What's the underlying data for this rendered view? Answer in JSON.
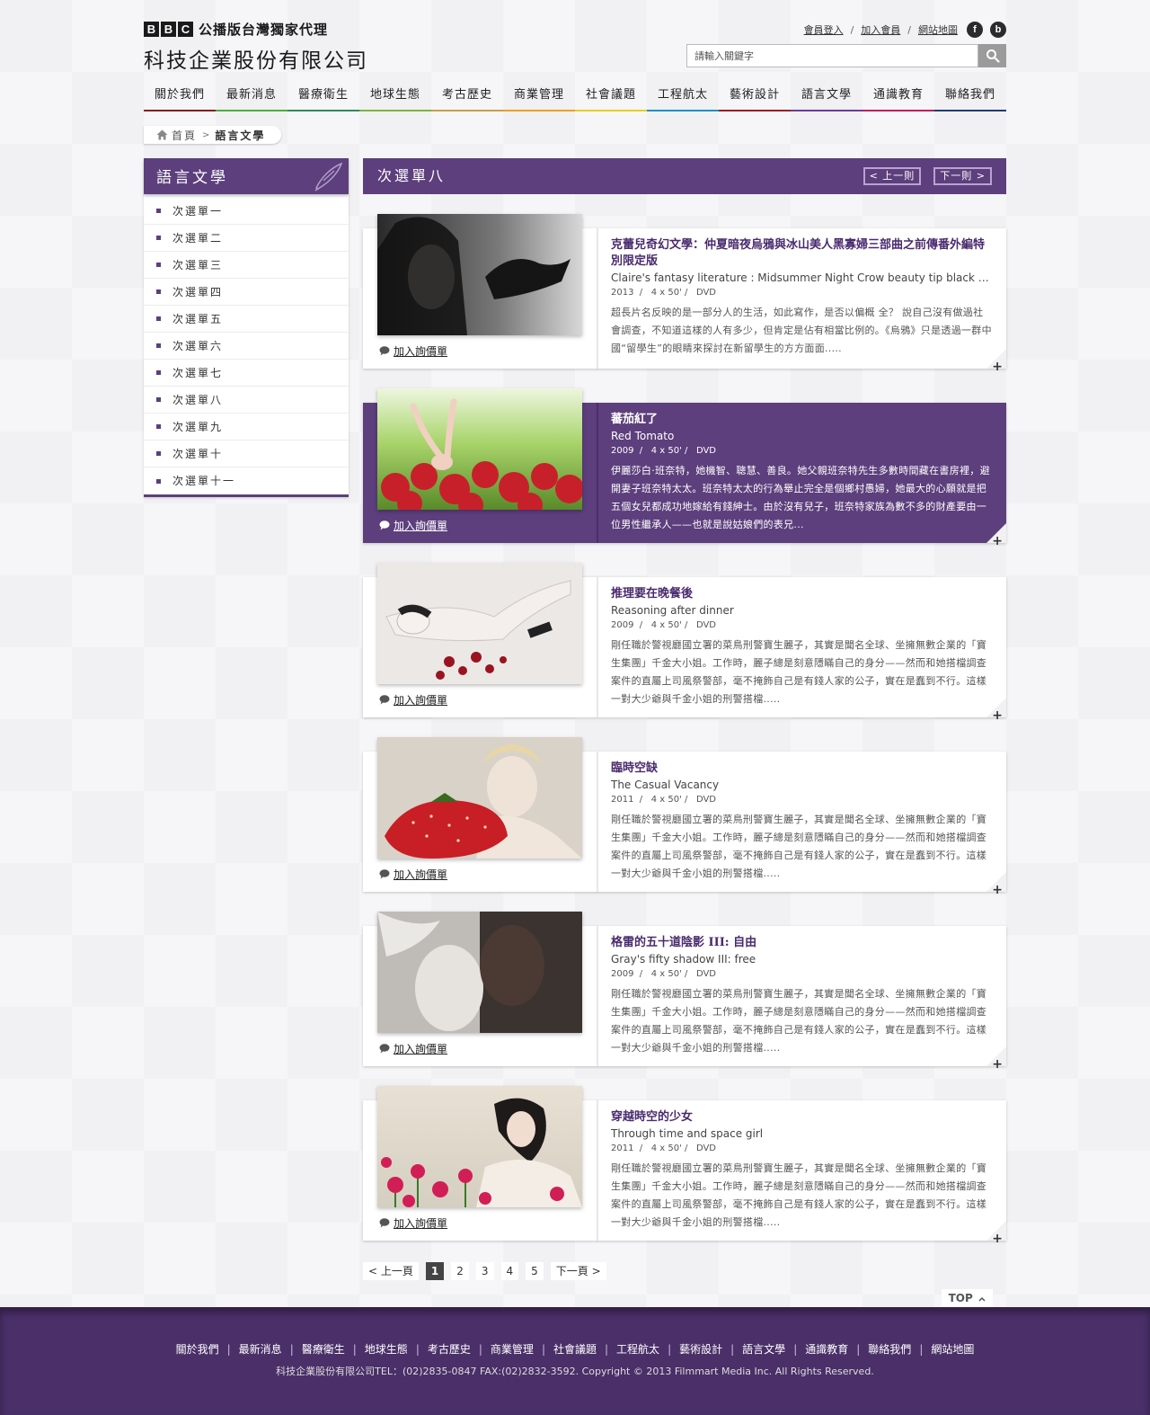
{
  "brand": {
    "bbc_letters": [
      "B",
      "B",
      "C"
    ],
    "subtitle": "公播版台灣獨家代理",
    "company": "科技企業股份有限公司"
  },
  "toplinks": {
    "login": "會員登入",
    "join": "加入會員",
    "sitemap": "網站地圖",
    "sep": "/",
    "facebook": "f",
    "blog": "b"
  },
  "search": {
    "placeholder": "請輸入關鍵字"
  },
  "nav": [
    {
      "label": "關於我們",
      "color": "#8b1a1a"
    },
    {
      "label": "最新消息",
      "color": "#4caf3a"
    },
    {
      "label": "醫療衛生",
      "color": "#2e8b57"
    },
    {
      "label": "地球生態",
      "color": "#7cb342"
    },
    {
      "label": "考古歷史",
      "color": "#c8a04a"
    },
    {
      "label": "商業管理",
      "color": "#f0a020"
    },
    {
      "label": "社會議題",
      "color": "#e8d020"
    },
    {
      "label": "工程航太",
      "color": "#1e90c8"
    },
    {
      "label": "藝術設計",
      "color": "#a01818"
    },
    {
      "label": "語言文學",
      "color": "#6a3d9a"
    },
    {
      "label": "通識教育",
      "color": "#c2185b"
    },
    {
      "label": "聯絡我們",
      "color": "#1a3a7a"
    }
  ],
  "breadcrumb": {
    "home": "首頁",
    "arrow": ">",
    "current": "語言文學"
  },
  "sidebar": {
    "title": "語言文學",
    "items": [
      "次選單一",
      "次選單二",
      "次選單三",
      "次選單四",
      "次選單五",
      "次選單六",
      "次選單七",
      "次選單八",
      "次選單九",
      "次選單十",
      "次選單十一"
    ]
  },
  "content": {
    "title": "次選單八",
    "prev": "< 上一則",
    "next": "下一則 >",
    "inquire_label": "加入詢價單",
    "plus": "+"
  },
  "products": [
    {
      "title": "克蕾兒奇幻文學：仲夏暗夜烏鴉與冰山美人黑寡婦三部曲之前傳番外編特別限定版",
      "en": "Claire's fantasy literature : Midsummer Night Crow beauty tip black widow...",
      "year": "2013",
      "episodes": "4 x 50'",
      "format": "DVD",
      "desc": "超長片名反映的是一部分人的生活，如此寫作，是否以偏概 全？ 說自己沒有做過社會調查，不知道這樣的人有多少，但肯定是佔有相當比例的。《烏鴉》只是透過一群中國“留學生”的眼睛來探討在新留學生的方方面面.....",
      "active": false
    },
    {
      "title": "蕃茄紅了",
      "en": "Red Tomato",
      "year": "2009",
      "episodes": "4 x 50'",
      "format": "DVD",
      "desc": "伊麗莎白·班奈特，她機智、聰慧、善良。她父親班奈特先生多數時間藏在書房裡，避開妻子班奈特太太。班奈特太太的行為舉止完全是個鄉村愚婦，她最大的心願就是把五個女兒都成功地嫁給有錢紳士。由於沒有兒子，班奈特家族為數不多的財產要由一位男性繼承人——也就是說姑娘們的表兄...",
      "active": true
    },
    {
      "title": "推理要在晚餐後",
      "en": "Reasoning after dinner",
      "year": "2009",
      "episodes": "4 x 50'",
      "format": "DVD",
      "desc": "剛任職於警視廳國立署的菜鳥刑警寶生麗子，其實是聞名全球、坐擁無數企業的「寶生集團」千金大小姐。工作時，麗子總是刻意隱瞞自己的身分——然而和她搭檔調查案件的直屬上司風祭警部，毫不掩飾自己是有錢人家的公子，實在是蠢到不行。這樣一對大少爺與千金小姐的刑警搭檔.....",
      "active": false
    },
    {
      "title": "臨時空缺",
      "en": "The Casual Vacancy",
      "year": "2011",
      "episodes": "4 x 50'",
      "format": "DVD",
      "desc": "剛任職於警視廳國立署的菜鳥刑警寶生麗子，其實是聞名全球、坐擁無數企業的「寶生集團」千金大小姐。工作時，麗子總是刻意隱瞞自己的身分——然而和她搭檔調查案件的直屬上司風祭警部，毫不掩飾自己是有錢人家的公子，實在是蠢到不行。這樣一對大少爺與千金小姐的刑警搭檔.....",
      "active": false
    },
    {
      "title": "格雷的五十道陰影 III: 自由",
      "en": "Gray's fifty shadow III: free",
      "year": "2009",
      "episodes": "4 x 50'",
      "format": "DVD",
      "desc": "剛任職於警視廳國立署的菜鳥刑警寶生麗子，其實是聞名全球、坐擁無數企業的「寶生集團」千金大小姐。工作時，麗子總是刻意隱瞞自己的身分——然而和她搭檔調查案件的直屬上司風祭警部，毫不掩飾自己是有錢人家的公子，實在是蠢到不行。這樣一對大少爺與千金小姐的刑警搭檔.....",
      "active": false
    },
    {
      "title": "穿越時空的少女",
      "en": "Through time and space girl",
      "year": "2011",
      "episodes": "4 x 50'",
      "format": "DVD",
      "desc": "剛任職於警視廳國立署的菜鳥刑警寶生麗子，其實是聞名全球、坐擁無數企業的「寶生集團」千金大小姐。工作時，麗子總是刻意隱瞞自己的身分——然而和她搭檔調查案件的直屬上司風祭警部，毫不掩飾自己是有錢人家的公子，實在是蠢到不行。這樣一對大少爺與千金小姐的刑警搭檔.....",
      "active": false
    }
  ],
  "pagination": {
    "prev": "< 上一頁",
    "pages": [
      "1",
      "2",
      "3",
      "4",
      "5"
    ],
    "current": "1",
    "next": "下一頁 >"
  },
  "top_label": "TOP",
  "footer": {
    "links": [
      "關於我們",
      "最新消息",
      "醫療衛生",
      "地球生態",
      "考古歷史",
      "商業管理",
      "社會議題",
      "工程航太",
      "藝術設計",
      "語言文學",
      "通識教育",
      "聯絡我們",
      "網站地圖"
    ],
    "sep": "|",
    "copyright": "科技企業股份有限公司TEL：(02)2835-0847   FAX:(02)2832-3592. Copyright © 2013 Filmmart Media Inc. All Rights Reserved."
  },
  "colors": {
    "purple": "#5c3f7c",
    "footer": "#4a2f68"
  }
}
